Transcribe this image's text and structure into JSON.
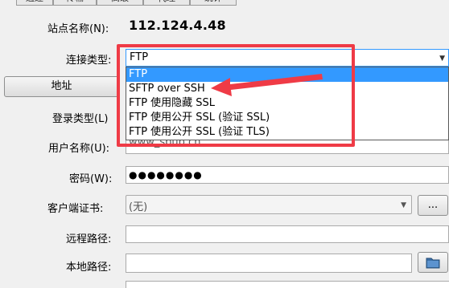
{
  "tabs": [
    "通过",
    "传输",
    "高级",
    "代理",
    "统计"
  ],
  "sidebar": {
    "address_button": "地址"
  },
  "form": {
    "site_label": "站点名称(N):",
    "site_value": "112.124.4.48",
    "conn_type_label": "连接类型:",
    "conn_type_value": "FTP",
    "login_type_label": "登录类型(L)",
    "username_label": "用户名称(U):",
    "username_value": "www_sbub.cn",
    "password_label": "密码(W):",
    "password_value": "●●●●●●●●",
    "client_cert_label": "客户端证书:",
    "client_cert_value": "(无)",
    "browse_label": "...",
    "remote_path_label": "远程路径:",
    "local_path_label": "本地路径:"
  },
  "dropdown_options": [
    "FTP",
    "SFTP over SSH",
    "FTP 使用隐藏 SSL",
    "FTP 使用公开 SSL (验证 SSL)",
    "FTP 使用公开 SSL (验证 TLS)"
  ],
  "colors": {
    "highlight": "#3399ff",
    "annotation": "#ef3b46"
  },
  "icons": {
    "combo_arrow": "chevron-down-icon",
    "folder": "folder-icon"
  }
}
